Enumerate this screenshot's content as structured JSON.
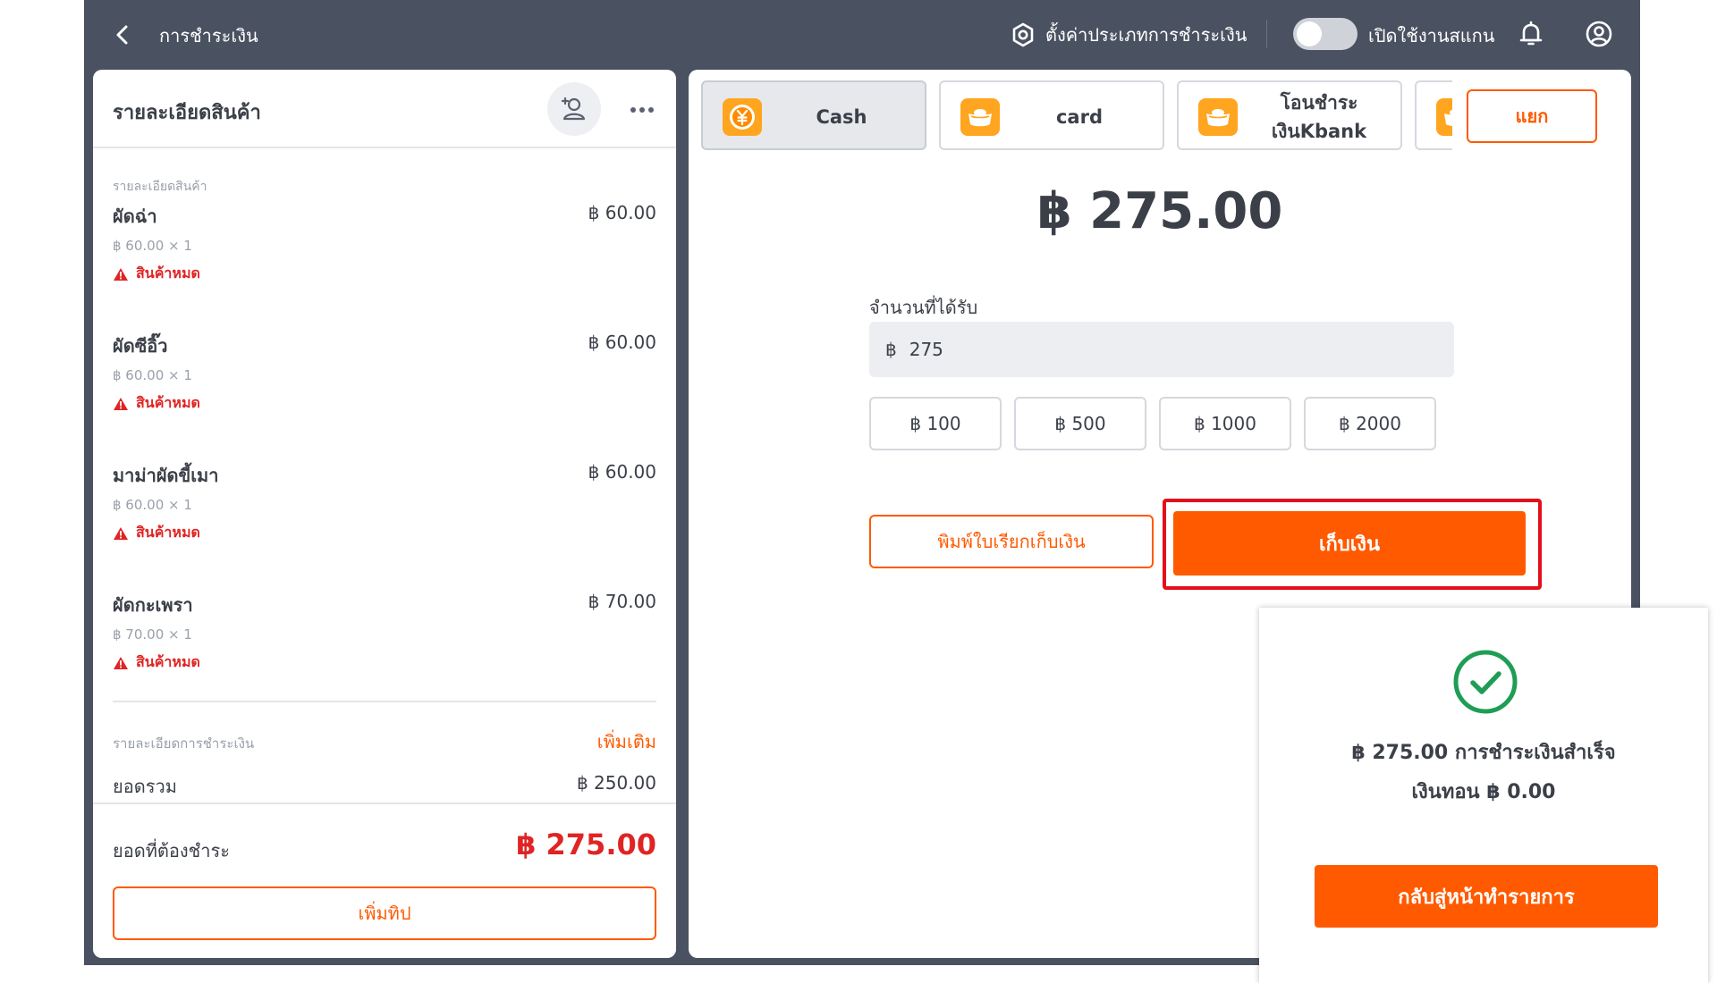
{
  "header": {
    "title": "การชำระเงิน",
    "settings_label": "ตั้งค่าประเภทการชำระเงิน",
    "scan_label": "เปิดใช้งานสแกน",
    "scan_enabled": false
  },
  "order": {
    "title": "รายละเอียดสินค้า",
    "section_label": "รายละเอียดสินค้า",
    "items": [
      {
        "name": "ผัดฉ่า",
        "price": "฿ 60.00",
        "qty": "฿ 60.00 × 1",
        "status": "สินค้าหมด"
      },
      {
        "name": "ผัดซีอิ๊ว",
        "price": "฿ 60.00",
        "qty": "฿ 60.00 × 1",
        "status": "สินค้าหมด"
      },
      {
        "name": "มาม่าผัดขี้เมา",
        "price": "฿ 60.00",
        "qty": "฿ 60.00 × 1",
        "status": "สินค้าหมด"
      },
      {
        "name": "ผัดกะเพรา",
        "price": "฿ 70.00",
        "qty": "฿ 70.00 × 1",
        "status": "สินค้าหมด"
      }
    ],
    "payment_section_label": "รายละเอียดการชำระเงิน",
    "add_more_label": "เพิ่มเติม",
    "subtotal_label": "ยอดรวม",
    "subtotal_value": "฿ 250.00",
    "total_label": "ยอดที่ต้องชำระ",
    "total_value": "฿ 275.00",
    "add_tip_label": "เพิ่มทิป"
  },
  "payment": {
    "methods": [
      {
        "label": "Cash",
        "icon": "yen-coin-icon",
        "active": true
      },
      {
        "label": "card",
        "icon": "gold-ingot-icon",
        "active": false
      },
      {
        "label": "โอนชำระเงินKbank",
        "icon": "gold-ingot-icon",
        "active": false
      },
      {
        "label": "",
        "icon": "gold-ingot-icon",
        "active": false
      }
    ],
    "split_label": "แยก",
    "amount": "฿ 275.00",
    "received_label": "จำนวนที่ได้รับ",
    "currency_symbol": "฿",
    "received_value": "275",
    "quick_amounts": [
      "฿ 100",
      "฿ 500",
      "฿ 1000",
      "฿ 2000"
    ],
    "print_label": "พิมพ์ใบเรียกเก็บเงิน",
    "collect_label": "เก็บเงิน"
  },
  "popup": {
    "message": "฿ 275.00 การชำระเงินสำเร็จ",
    "change": "เงินทอน ฿ 0.00",
    "button_label": "กลับสู่หน้าทำรายการ"
  },
  "colors": {
    "accent": "#ff5a00",
    "header_bg": "#4a5160",
    "danger": "#e02424",
    "success": "#1f9d55",
    "icon_bg": "#ffa51f"
  }
}
